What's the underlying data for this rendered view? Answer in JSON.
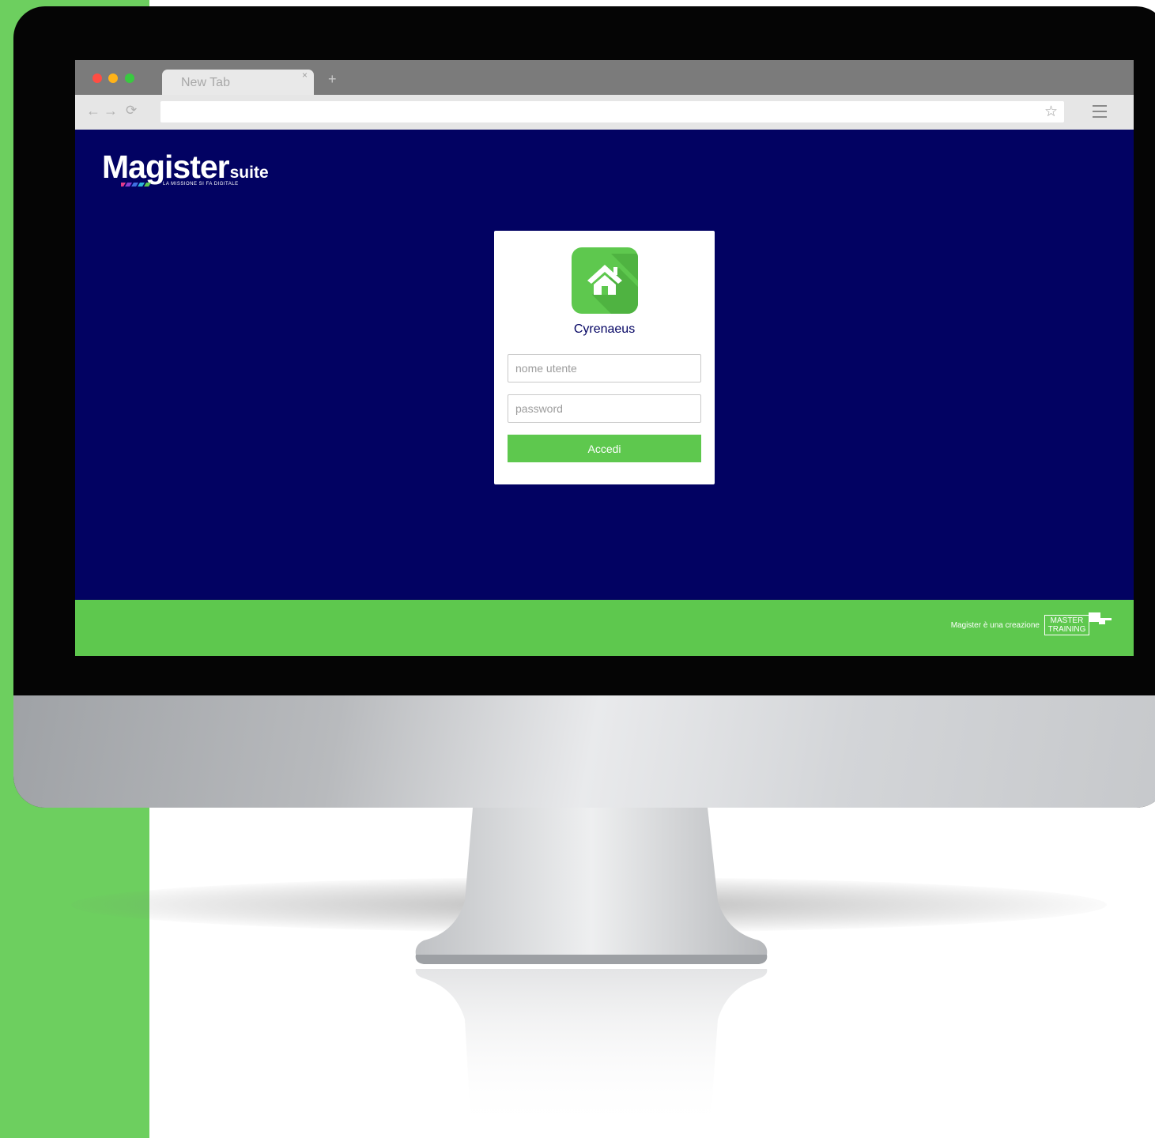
{
  "browser": {
    "tab_title": "New Tab",
    "tab_close": "×",
    "new_tab": "+",
    "nav_back": "←",
    "nav_forward": "→",
    "nav_reload": "⟳",
    "bookmark_icon": "star-icon",
    "menu_icon": "menu-icon"
  },
  "brand": {
    "logo_word": "Magister",
    "logo_suite": "suite",
    "tagline": "LA MISSIONE SI FA DIGITALE"
  },
  "login": {
    "app_icon": "house-icon",
    "app_name": "Cyrenaeus",
    "username_placeholder": "nome utente",
    "password_placeholder": "password",
    "submit_label": "Accedi"
  },
  "footer": {
    "credit_text": "Magister è una creazione",
    "partner_line1": "MASTER",
    "partner_line2": "TRAINING"
  },
  "colors": {
    "page_background": "#020262",
    "accent_green": "#5ec84e",
    "side_strip_green": "#6dcf5f"
  }
}
